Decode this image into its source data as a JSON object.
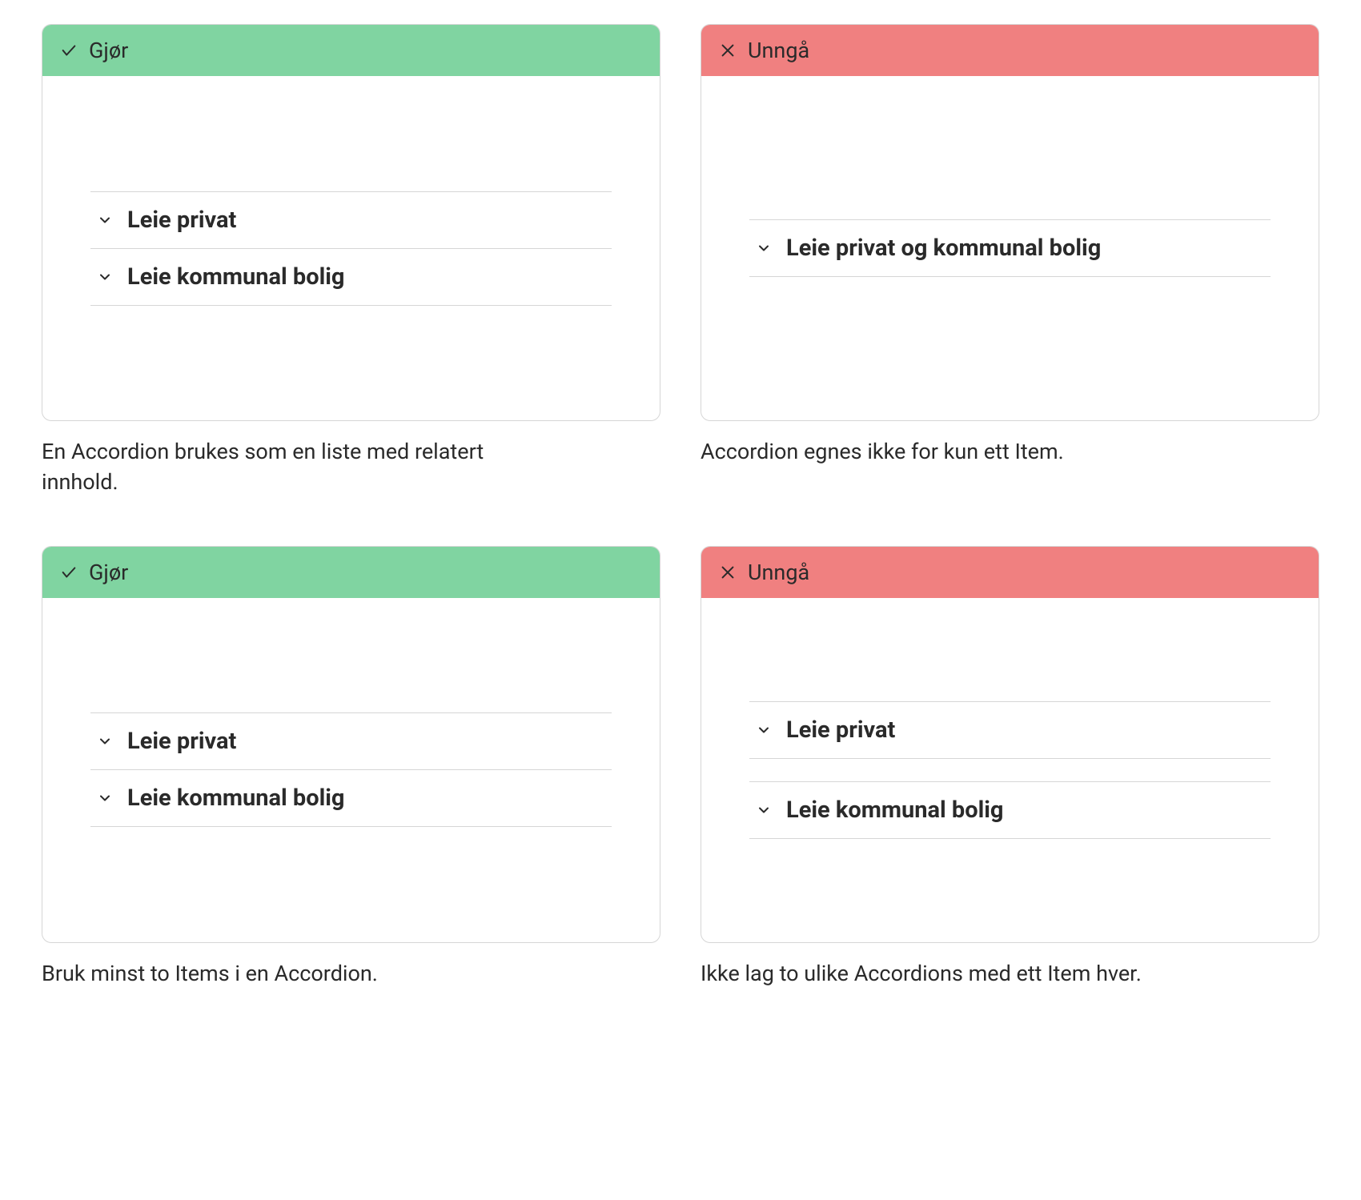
{
  "labels": {
    "do": "Gjør",
    "avoid": "Unngå"
  },
  "examples": [
    {
      "type": "do",
      "accordions": [
        {
          "items": [
            "Leie privat",
            "Leie kommunal bolig"
          ]
        }
      ],
      "caption": "En Accordion brukes som en liste med relatert innhold."
    },
    {
      "type": "avoid",
      "accordions": [
        {
          "items": [
            "Leie privat og kommunal bolig"
          ]
        }
      ],
      "caption": "Accordion egnes ikke for kun ett Item."
    },
    {
      "type": "do",
      "accordions": [
        {
          "items": [
            "Leie privat",
            "Leie kommunal bolig"
          ]
        }
      ],
      "caption": "Bruk minst to Items i en Accordion."
    },
    {
      "type": "avoid",
      "accordions": [
        {
          "items": [
            "Leie privat"
          ]
        },
        {
          "items": [
            "Leie kommunal bolig"
          ]
        }
      ],
      "caption": "Ikke lag to ulike Accordions med ett Item hver."
    }
  ]
}
